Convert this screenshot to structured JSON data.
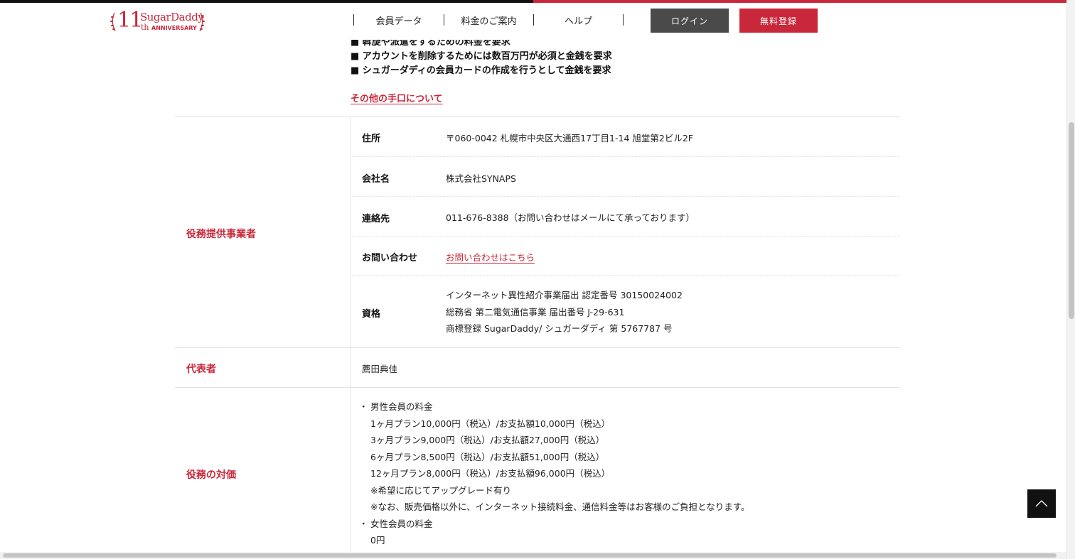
{
  "header": {
    "logo": {
      "number": "11",
      "brand": "SugarDaddy",
      "suffix": "th",
      "anniversary": "ANNIVERSARY"
    },
    "nav": [
      {
        "label": "会員データ"
      },
      {
        "label": "料金のご案内"
      },
      {
        "label": "ヘルプ"
      }
    ],
    "login_label": "ログイン",
    "signup_label": "無料登録"
  },
  "fraud": {
    "items": [
      "■ 斡旋や派遣をするための料金を要求",
      "■ アカウントを削除するためには数百万円が必須と金銭を要求",
      "■ シュガーダディの会員カードの作成を行うとして金銭を要求"
    ],
    "link_label": "その他の手口について"
  },
  "provider": {
    "label": "役務提供事業者",
    "rows": [
      {
        "key": "住所",
        "value": "〒060-0042 札幌市中央区大通西17丁目1-14 旭堂第2ビル2F"
      },
      {
        "key": "会社名",
        "value": "株式会社SYNAPS"
      },
      {
        "key": "連絡先",
        "value": "011-676-8388（お問い合わせはメールにて承っております）"
      },
      {
        "key": "お問い合わせ",
        "value": "お問い合わせはこちら"
      },
      {
        "key": "資格",
        "lines": [
          "インターネット異性紹介事業届出 認定番号 30150024002",
          "総務省 第二電気通信事業 届出番号 J-29-631",
          "商標登録 SugarDaddy/ シュガーダディ 第 5767787 号"
        ]
      }
    ]
  },
  "representative": {
    "label": "代表者",
    "value": "薦田典佳"
  },
  "pricing": {
    "label": "役務の対価",
    "male_title": "男性会員の料金",
    "male_lines": [
      "1ヶ月プラン10,000円（税込）/お支払額10,000円（税込）",
      "3ヶ月プラン9,000円（税込）/お支払額27,000円（税込）",
      "6ヶ月プラン8,500円（税込）/お支払額51,000円（税込）",
      "12ヶ月プラン8,000円（税込）/お支払額96,000円（税込）",
      "※希望に応じてアップグレード有り",
      "※なお、販売価格以外に、インターネット接続料金、通信料金等はお客様のご負担となります。"
    ],
    "female_title": "女性会員の料金",
    "female_lines": [
      "0円"
    ]
  },
  "colors": {
    "accent": "#c8283a",
    "login_bg": "#4a4a4a",
    "to_top_bg": "#111111"
  },
  "icons": {
    "to_top": "chevron-up-icon",
    "logo_wreath": "laurel-icon"
  }
}
